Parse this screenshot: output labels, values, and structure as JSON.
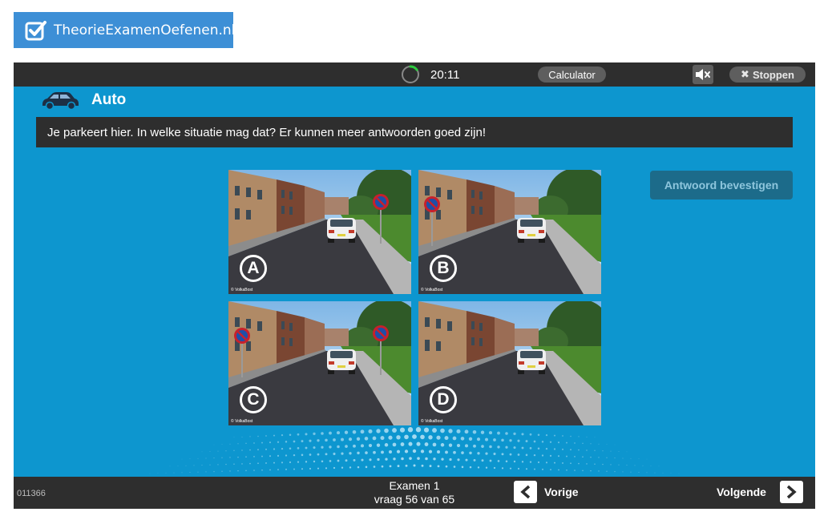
{
  "logo": {
    "text": "TheorieExamenOefenen.nl"
  },
  "topbar": {
    "timer": "20:11",
    "timer_progress": 0.15,
    "calculator_label": "Calculator",
    "mute_icon": "speaker-mute-icon",
    "stop_label": "Stoppen"
  },
  "category": {
    "label": "Auto",
    "icon": "car-icon"
  },
  "question": {
    "text": "Je parkeert hier. In welke situatie mag dat? Er kunnen meer antwoorden goed zijn!"
  },
  "options": [
    {
      "letter": "A",
      "copyright": "© VolkaBost"
    },
    {
      "letter": "B",
      "copyright": "© VolkaBost"
    },
    {
      "letter": "C",
      "copyright": "© VolkaBost"
    },
    {
      "letter": "D",
      "copyright": "© VolkaBost"
    }
  ],
  "confirm_label": "Antwoord bevestigen",
  "footer": {
    "question_id": "011366",
    "exam_title": "Examen 1",
    "progress": "vraag 56 van 65",
    "prev_label": "Vorige",
    "next_label": "Volgende"
  },
  "colors": {
    "brand_blue": "#3d8fd6",
    "app_blue": "#0d96cf",
    "dark_bar": "#2e2e2e",
    "confirm_bg": "#1c6b8a",
    "timer_green": "#2ecc40"
  }
}
